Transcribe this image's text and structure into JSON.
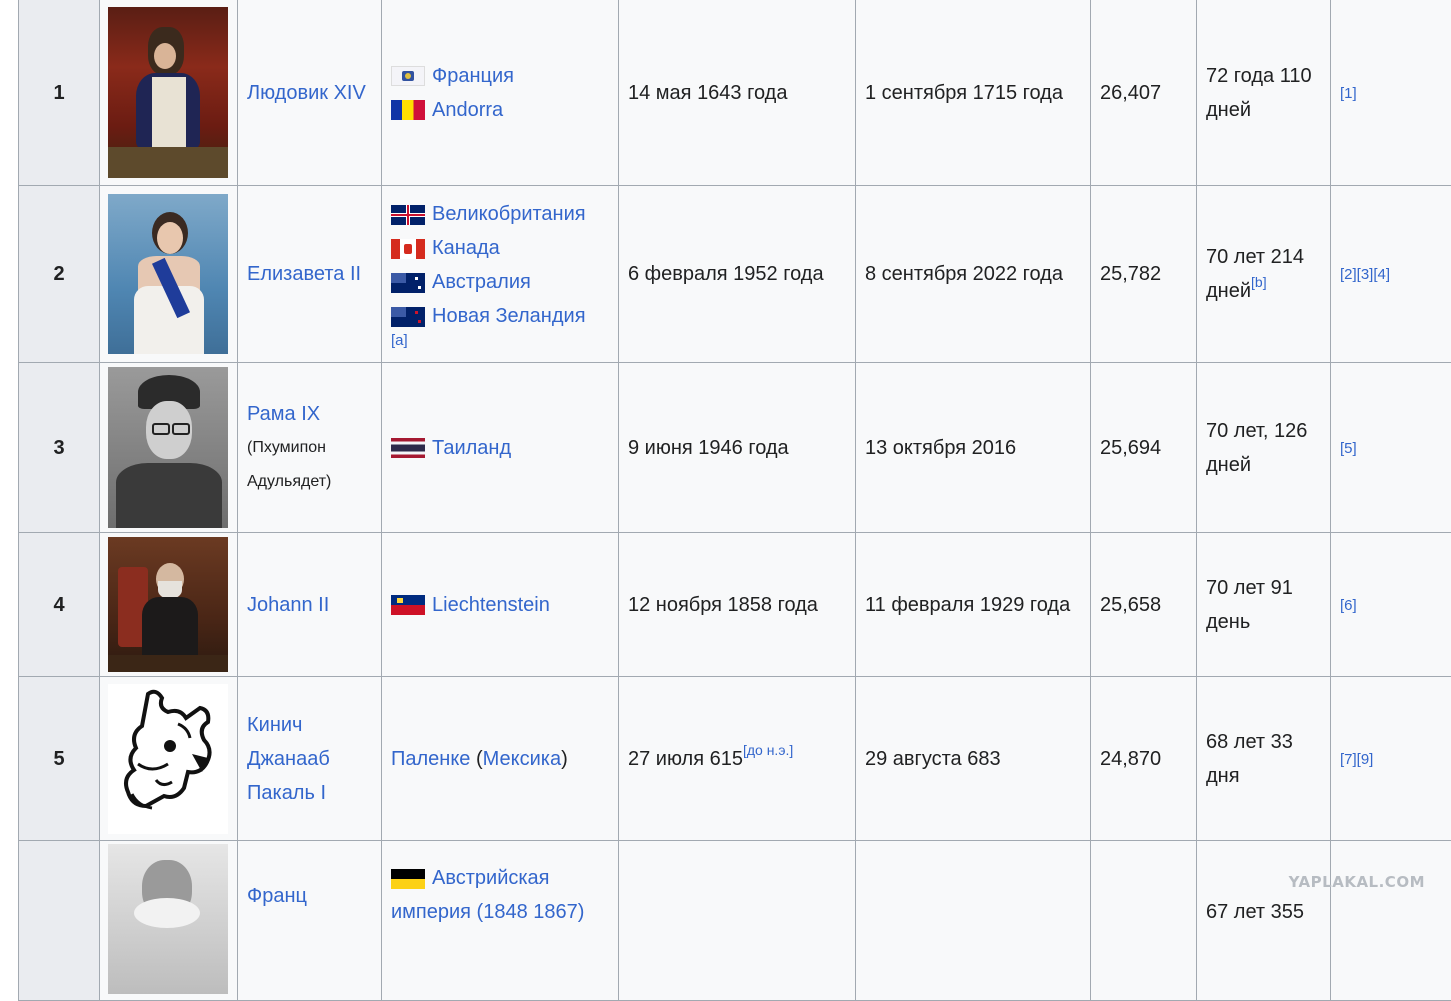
{
  "rows": [
    {
      "rank": "1",
      "name": "Людовик XIV",
      "countries": [
        "Франция",
        "Andorra"
      ],
      "start": "14 мая 1643 года",
      "end": "1 сентября 1715 года",
      "days": "26,407",
      "duration_a": "72 года 110",
      "duration_b": "дней",
      "refs": "[1]",
      "portrait_icon": "portrait-louis-xiv"
    },
    {
      "rank": "2",
      "name": "Елизавета II",
      "countries": [
        "Великобритания",
        "Канада",
        "Австралия",
        "Новая Зеландия"
      ],
      "country_note": "[a]",
      "start": "6 февраля 1952 года",
      "end": "8 сентября 2022 года",
      "days": "25,782",
      "duration_a": "70 лет 214",
      "duration_b": "дней",
      "duration_note": "[b]",
      "refs": "[2][3][4]",
      "portrait_icon": "portrait-elizabeth-ii"
    },
    {
      "rank": "3",
      "name": "Рама IX",
      "name_sub_1": "(Пхумипон",
      "name_sub_2": "Адульядет)",
      "countries": [
        "Таиланд"
      ],
      "start": "9 июня 1946 года",
      "end": "13 октября 2016",
      "days": "25,694",
      "duration_a": "70 лет, 126",
      "duration_b": "дней",
      "refs": "[5]",
      "portrait_icon": "portrait-rama-ix"
    },
    {
      "rank": "4",
      "name": "Johann II",
      "countries": [
        "Liechtenstein"
      ],
      "start": "12 ноября 1858 года",
      "end": "11 февраля 1929 года",
      "days": "25,658",
      "duration_a": "70 лет 91",
      "duration_b": "день",
      "refs": "[6]",
      "portrait_icon": "portrait-johann-ii"
    },
    {
      "rank": "5",
      "name_lines": [
        "Кинич",
        "Джанааб",
        "Пакаль I"
      ],
      "place": "Паленке",
      "place_paren_open": " (",
      "place_country": "Мексика",
      "place_paren_close": ")",
      "start": "27 июля 615",
      "start_note": "[до н.э.]",
      "end": "29 августа 683",
      "days": "24,870",
      "duration_a": "68 лет 33",
      "duration_b": "дня",
      "refs": "[7][9]",
      "portrait_icon": "portrait-pakal-glyph"
    },
    {
      "rank": "",
      "name": "Франц",
      "countries": [
        "Австрийская"
      ],
      "country_line_2": "империя (1848 1867)",
      "duration_a": "67 лет 355",
      "portrait_icon": "portrait-franz-joseph"
    }
  ],
  "watermark": "YAPLAKAL.COM",
  "colors": {
    "link": "#3366cc",
    "border": "#a2a9b1",
    "cell": "#f8f9fa",
    "rank_cell": "#eaecf0"
  }
}
